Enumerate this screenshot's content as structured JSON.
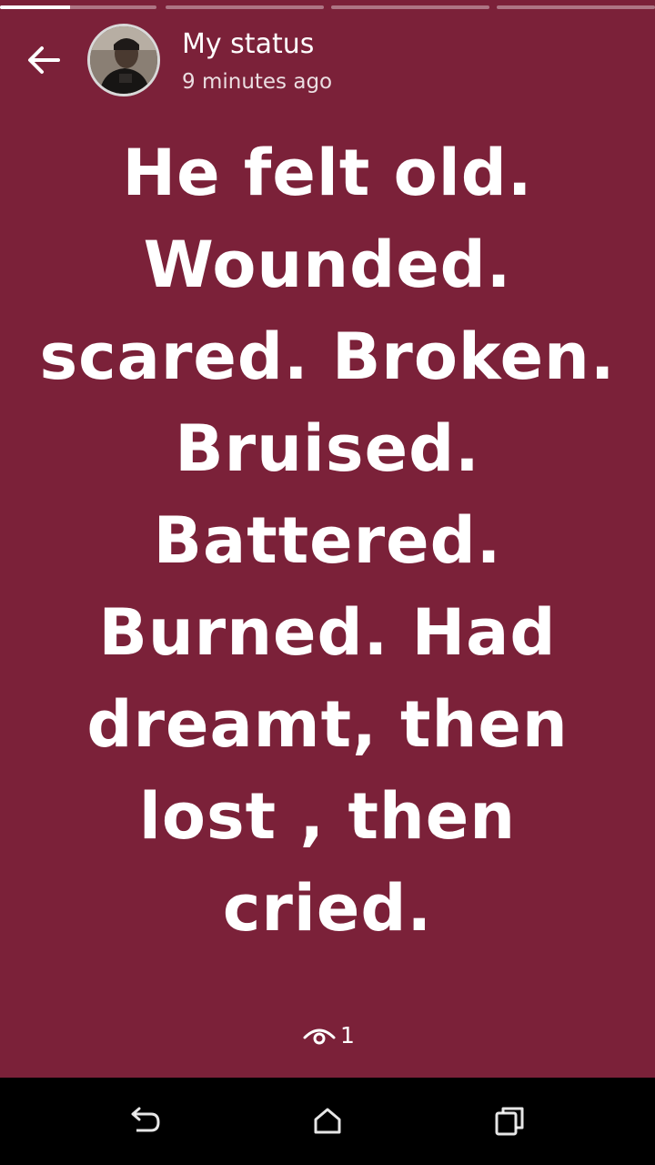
{
  "colors": {
    "status_background": "#7b2139",
    "text": "#ffffff",
    "nav_bar": "#000000"
  },
  "progress": {
    "segment_count": 4,
    "current_segment": 1,
    "current_fill_fraction": 0.45
  },
  "header": {
    "back_icon": "arrow-left-icon",
    "contact_name": "My status",
    "timestamp": "9 minutes ago"
  },
  "status": {
    "lines": [
      "He felt old.",
      "Wounded.",
      "scared. Broken.",
      "Bruised.",
      "Battered.",
      "Burned. Had",
      "dreamt, then",
      "lost , then",
      "cried."
    ]
  },
  "views": {
    "icon": "eye-icon",
    "count": "1"
  },
  "nav_bar": {
    "back_icon": "nav-back-icon",
    "home_icon": "nav-home-icon",
    "recents_icon": "nav-recents-icon"
  }
}
